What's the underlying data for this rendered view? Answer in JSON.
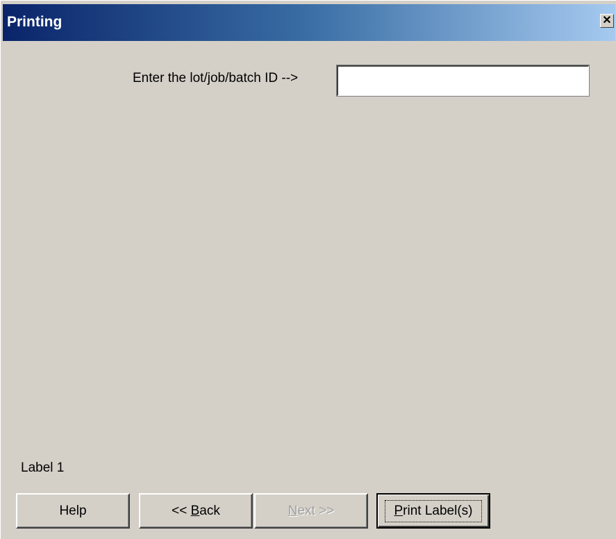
{
  "window": {
    "title": "Printing",
    "close_icon": "close-icon",
    "close_glyph": "✕"
  },
  "form": {
    "prompt_label": "Enter the lot/job/batch ID -->",
    "id_value": "",
    "id_placeholder": ""
  },
  "status": {
    "label": "Label 1"
  },
  "buttons": {
    "help": "Help",
    "back_prefix": "<< ",
    "back_accel": "B",
    "back_rest": "ack",
    "next_accel": "N",
    "next_rest": "ext >>",
    "print_accel": "P",
    "print_rest": "rint Label(s)"
  },
  "colors": {
    "titlebar_start": "#0a246a",
    "titlebar_end": "#a6caf0",
    "face": "#d4d0c8"
  }
}
